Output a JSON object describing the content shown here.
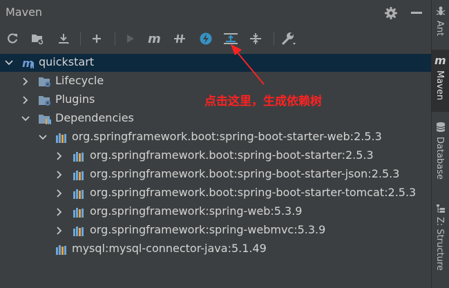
{
  "window": {
    "title": "Maven"
  },
  "toolbar": {
    "buttons": [
      {
        "icon": "refresh-icon"
      },
      {
        "icon": "generate-sources-icon"
      },
      {
        "icon": "download-icon"
      },
      {
        "icon": "add-icon"
      },
      {
        "icon": "run-icon"
      },
      {
        "icon": "execute-goal-icon"
      },
      {
        "icon": "toggle-offline-icon"
      },
      {
        "icon": "skip-tests-icon"
      },
      {
        "icon": "show-dependencies-icon"
      },
      {
        "icon": "collapse-all-icon"
      },
      {
        "icon": "settings-wrench-icon"
      }
    ]
  },
  "tree": {
    "root": "quickstart",
    "lifecycle": "Lifecycle",
    "plugins": "Plugins",
    "dependencies": "Dependencies",
    "dep_web": "org.springframework.boot:spring-boot-starter-web:2.5.3",
    "dep_children": [
      "org.springframework.boot:spring-boot-starter:2.5.3",
      "org.springframework.boot:spring-boot-starter-json:2.5.3",
      "org.springframework.boot:spring-boot-starter-tomcat:2.5.3",
      "org.springframework:spring-web:5.3.9",
      "org.springframework:spring-webmvc:5.3.9"
    ],
    "dep_mysql": "mysql:mysql-connector-java:5.1.49"
  },
  "annotation": {
    "text": "点击这里，生成依赖树"
  },
  "right_sidebar": {
    "tabs": [
      {
        "label": "Ant"
      },
      {
        "label": "Maven"
      },
      {
        "label": "Database"
      },
      {
        "label": "Z: Structure"
      }
    ]
  },
  "colors": {
    "background": "#3c3f41",
    "selected_row": "#0d293e",
    "annotation": "#ff2222"
  }
}
